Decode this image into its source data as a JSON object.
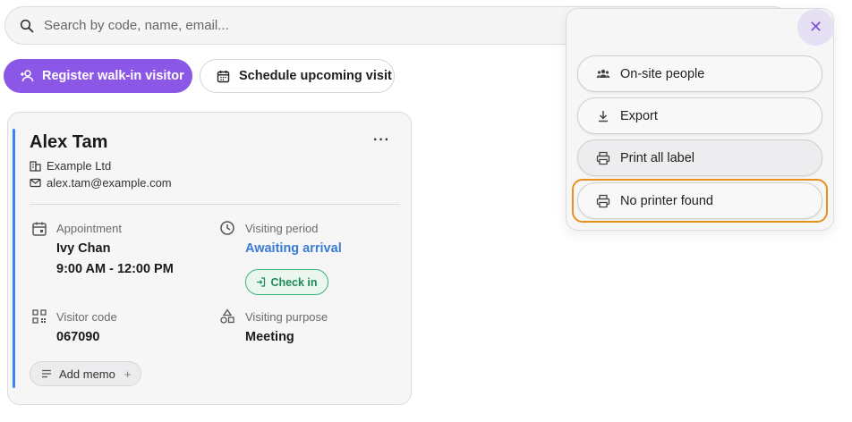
{
  "search": {
    "placeholder": "Search by code, name, email..."
  },
  "actions": {
    "register_label": "Register walk-in visitor",
    "schedule_label": "Schedule upcoming visit"
  },
  "visitor": {
    "name": "Alex Tam",
    "company": "Example Ltd",
    "email": "alex.tam@example.com",
    "more": "···",
    "appointment_label": "Appointment",
    "host": "Ivy Chan",
    "time_range": "9:00 AM - 12:00 PM",
    "visiting_period_label": "Visiting period",
    "status": "Awaiting arrival",
    "checkin_label": "Check in",
    "visitor_code_label": "Visitor code",
    "visitor_code": "067090",
    "visiting_purpose_label": "Visiting purpose",
    "purpose": "Meeting",
    "memo_label": "Add memo",
    "memo_plus": "+"
  },
  "menu": {
    "close": "✕",
    "items": [
      {
        "label": "On-site people",
        "icon": "people-icon"
      },
      {
        "label": "Export",
        "icon": "download-icon"
      },
      {
        "label": "Print all label",
        "icon": "printer-icon"
      },
      {
        "label": "No printer found",
        "icon": "printer-icon"
      }
    ]
  },
  "colors": {
    "primary": "#8b57e6",
    "accent_bar": "#3b82f6",
    "link": "#3a7bd5",
    "checkin_green": "#1e8a57",
    "highlight": "#e8901a"
  }
}
